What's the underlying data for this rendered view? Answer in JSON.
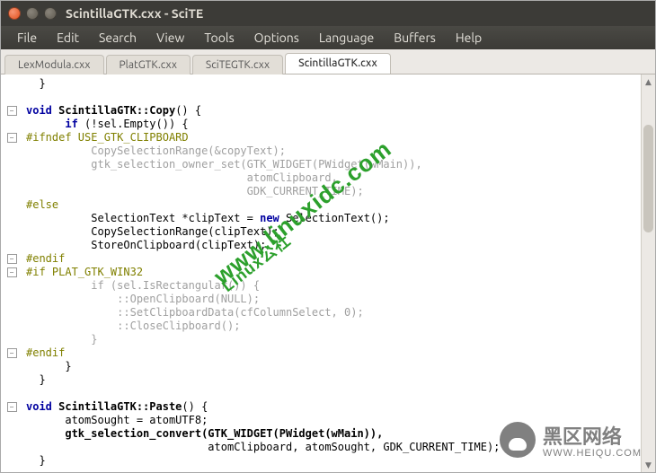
{
  "window": {
    "title": "ScintillaGTK.cxx - SciTE"
  },
  "menus": [
    "File",
    "Edit",
    "Search",
    "View",
    "Tools",
    "Options",
    "Language",
    "Buffers",
    "Help"
  ],
  "tabs": [
    {
      "label": "LexModula.cxx",
      "active": false
    },
    {
      "label": "PlatGTK.cxx",
      "active": false
    },
    {
      "label": "SciTEGTK.cxx",
      "active": false
    },
    {
      "label": "ScintillaGTK.cxx",
      "active": true
    }
  ],
  "code": {
    "l1": "  }",
    "l2": "",
    "l3a": "void",
    "l3b": " ScintillaGTK::Copy",
    "l3c": "() {",
    "l4a": "      if",
    "l4b": " (!sel.Empty()) {",
    "l5": "#ifndef USE_GTK_CLIPBOARD",
    "l6": "          CopySelectionRange(&copyText);",
    "l7": "          gtk_selection_owner_set(GTK_WIDGET(PWidget(wMain)),",
    "l8": "                                  atomClipboard,",
    "l9": "                                  GDK_CURRENT_TIME);",
    "l10": "#else",
    "l11a": "          SelectionText *clipText = ",
    "l11b": "new",
    "l11c": " SelectionText();",
    "l12": "          CopySelectionRange(clipText);",
    "l13": "          StoreOnClipboard(clipText);",
    "l14": "#endif",
    "l15": "#if PLAT_GTK_WIN32",
    "l16a": "          if",
    "l16b": " (sel.IsRectangular()) {",
    "l17": "              ::OpenClipboard(NULL);",
    "l18a": "              ::SetClipboardData(cfColumnSelect, ",
    "l18b": "0",
    "l18c": ");",
    "l19": "              ::CloseClipboard();",
    "l20": "          }",
    "l21": "#endif",
    "l22": "      }",
    "l23": "  }",
    "l24": "",
    "l25a": "void",
    "l25b": " ScintillaGTK::Paste",
    "l25c": "() {",
    "l26": "      atomSought = atomUTF8;",
    "l27": "      gtk_selection_convert(GTK_WIDGET(PWidget(wMain)),",
    "l28": "                            atomClipboard, atomSought, GDK_CURRENT_TIME);",
    "l29": "  }"
  },
  "watermark1": {
    "line1": "www.linuxidc.com",
    "line2": "Linux公社"
  },
  "watermark2": {
    "line1": "黑区网络",
    "line2": "WWW.HEIQU.COM"
  }
}
